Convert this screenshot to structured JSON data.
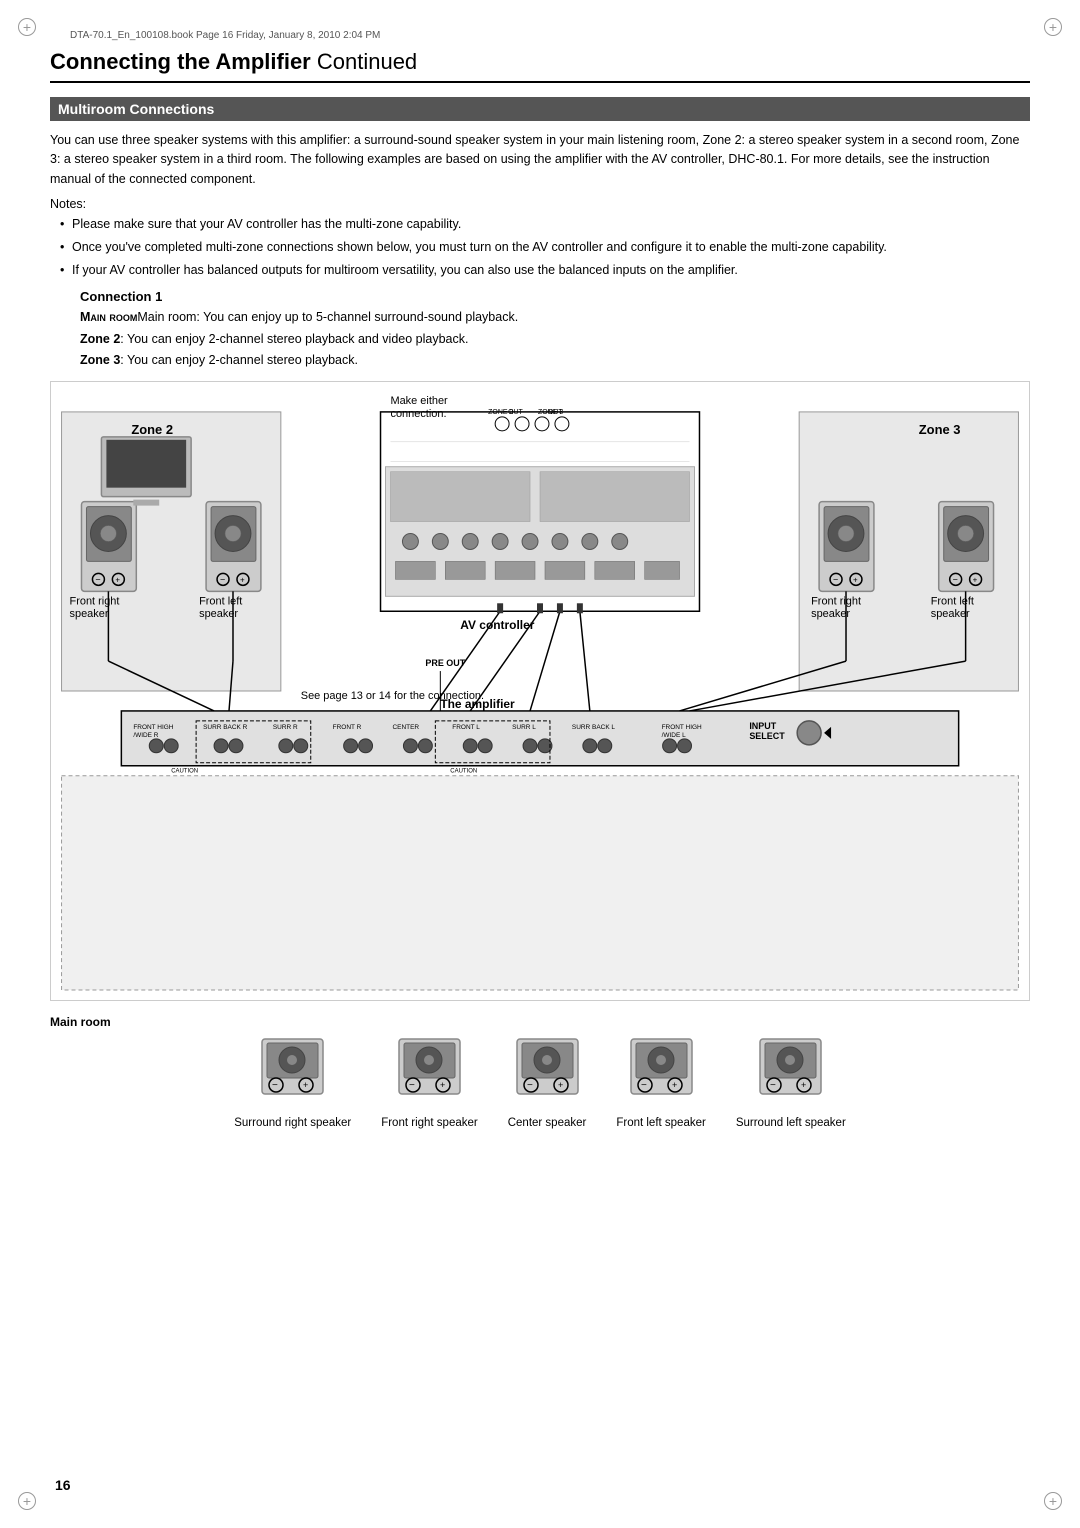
{
  "file_info": "DTA-70.1_En_100108.book  Page 16  Friday, January 8, 2010  2:04 PM",
  "page_title": "Connecting the Amplifier",
  "page_title_continued": " Continued",
  "section_header": "Multiroom Connections",
  "body_text": "You can use three speaker systems with this amplifier: a surround-sound speaker system in your main listening room, Zone 2: a stereo speaker system in a second room, Zone 3: a stereo speaker system in a third room. The following examples are based on using the amplifier with the AV controller, DHC-80.1. For more details, see the instruction manual of the connected component.",
  "notes_label": "Notes:",
  "bullets": [
    "Please make sure that your AV controller has the multi-zone capability.",
    "Once you've completed multi-zone connections shown below, you must turn on the AV controller and configure it to enable the multi-zone capability.",
    "If your AV controller has balanced outputs for multiroom versatility, you can also use the balanced inputs on the amplifier."
  ],
  "connection_title": "Connection 1",
  "connection_lines": [
    "Main room: You can enjoy up to 5-channel surround-sound playback.",
    "Zone 2: You can enjoy 2-channel stereo playback and video playback.",
    "Zone 3: You can enjoy 2-channel stereo playback."
  ],
  "diagram": {
    "zone2_label": "Zone 2",
    "zone3_label": "Zone 3",
    "av_controller_label": "AV controller",
    "amplifier_label": "The amplifier",
    "make_either_label": "Make either connection.",
    "see_page_label": "See page 13 or 14 for the connection.",
    "zone2_front_right": "Front right\nspeaker",
    "zone2_front_left": "Front left\nspeaker",
    "zone3_front_right": "Front right\nspeaker",
    "zone3_front_left": "Front left\nspeaker"
  },
  "main_room_label": "Main room",
  "bottom_speakers": [
    {
      "label": "Surround right\nspeaker"
    },
    {
      "label": "Front right\nspeaker"
    },
    {
      "label": "Center speaker"
    },
    {
      "label": "Front left\nspeaker"
    },
    {
      "label": "Surround left\nspeaker"
    }
  ],
  "page_number": "16"
}
